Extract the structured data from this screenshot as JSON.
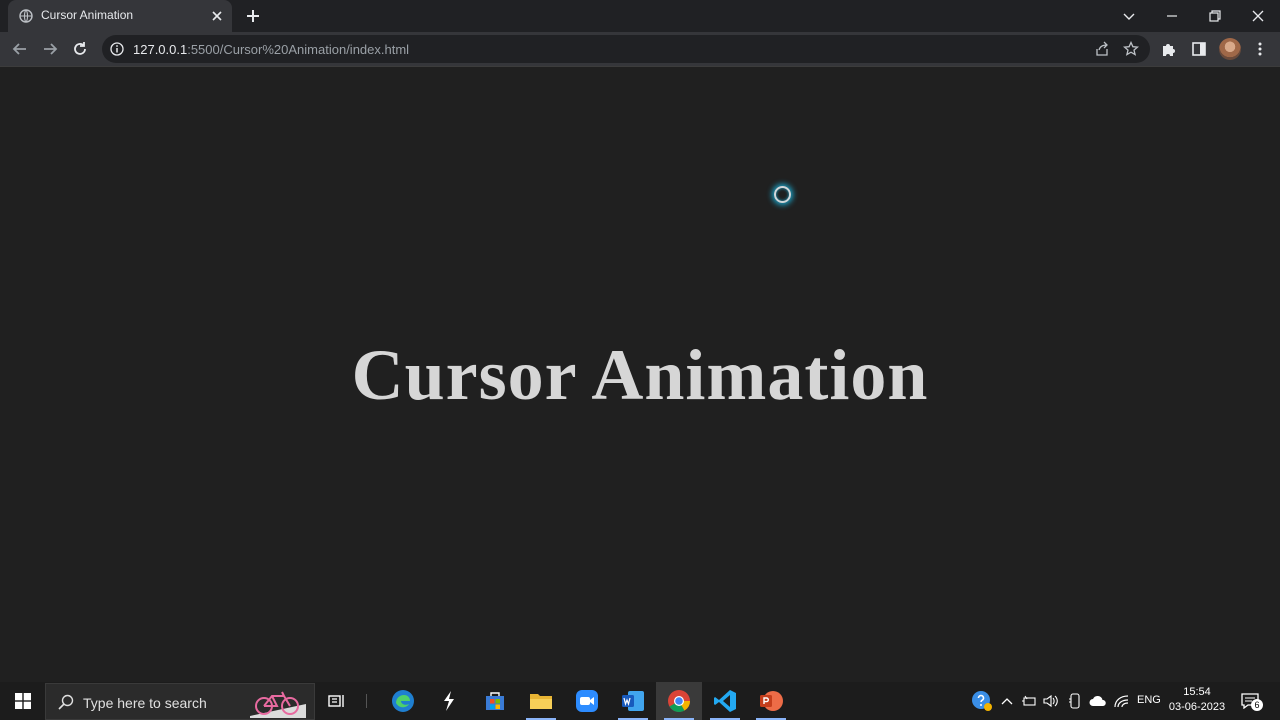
{
  "browser": {
    "tab": {
      "title": "Cursor Animation",
      "favicon": "globe-icon"
    },
    "url_host": "127.0.0.1",
    "url_path": ":5500/Cursor%20Animation/index.html"
  },
  "page": {
    "heading": "Cursor Animation",
    "cursor_glow_color": "#1aa3c8"
  },
  "taskbar": {
    "search_placeholder": "Type here to search",
    "apps": [
      "task-view",
      "edge",
      "dopamine",
      "microsoft-store",
      "file-explorer",
      "zoom",
      "word",
      "chrome",
      "vscode",
      "powerpoint"
    ],
    "language": "ENG",
    "time": "15:54",
    "date": "03-06-2023",
    "notification_count": "6"
  },
  "colors": {
    "background": "#202020",
    "heading": "#d6d6d6",
    "accent": "#8ab4f8"
  }
}
